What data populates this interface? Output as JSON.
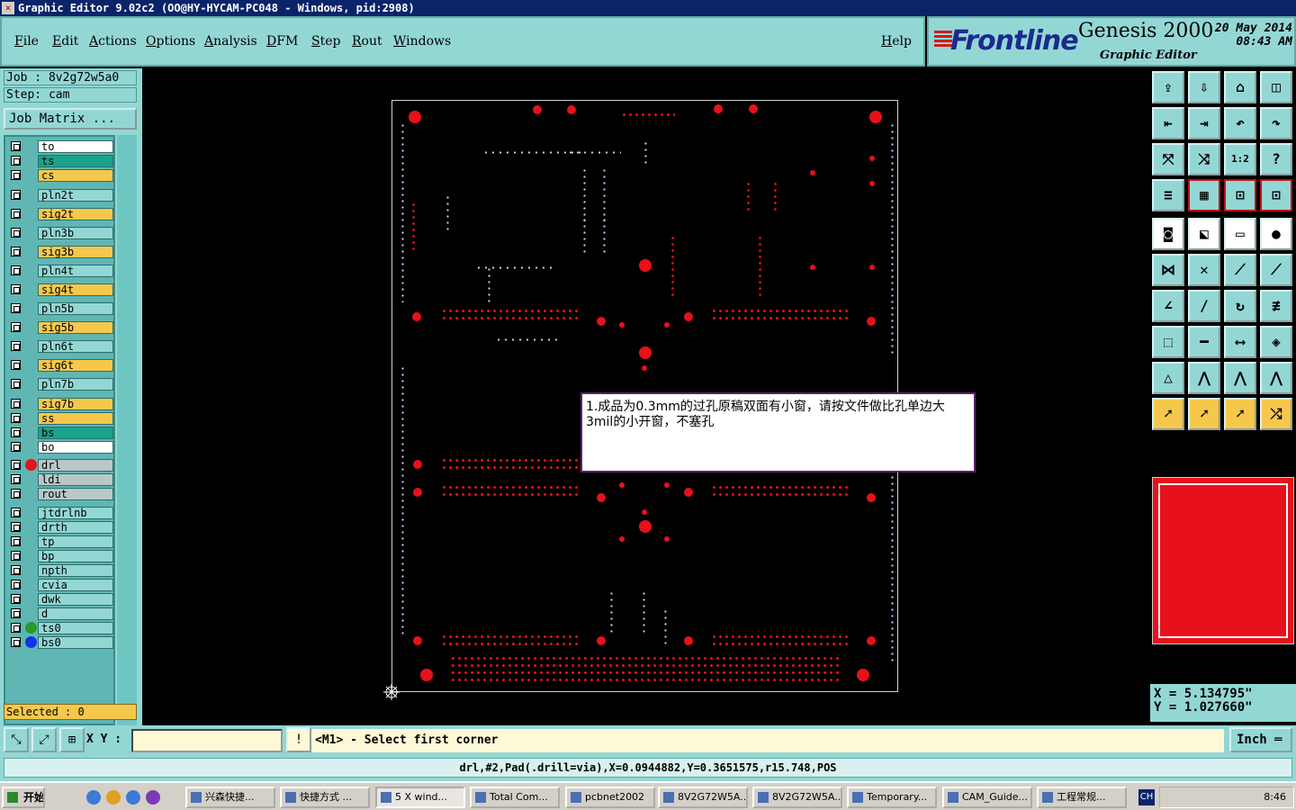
{
  "window": {
    "title": "Graphic Editor 9.02c2 (OO@HY-HYCAM-PC048 - Windows, pid:2908)"
  },
  "menu": {
    "file": "File",
    "edit": "Edit",
    "actions": "Actions",
    "options": "Options",
    "analysis": "Analysis",
    "dfm": "DFM",
    "step": "Step",
    "rout": "Rout",
    "windows": "Windows",
    "help": "Help"
  },
  "brand": {
    "logo": "Frontline",
    "product": "Genesis 2000",
    "subtitle": "Graphic Editor",
    "date": "20 May 2014",
    "time": "08:43 AM"
  },
  "job": {
    "job_line": "Job : 8v2g72w5a0",
    "step_line": "Step: cam",
    "matrix_button": "Job Matrix ..."
  },
  "colors": {
    "cyan": "#93d7d5",
    "green": "#1aa38a",
    "yellow": "#f5c84c",
    "white": "#ffffff",
    "gray": "#b8c8c8",
    "red": "#e8101a",
    "blue": "#1233e8",
    "darkgreen": "#2a9a2a"
  },
  "layers": [
    {
      "name": "to"
    },
    {
      "name": "ts"
    },
    {
      "name": "cs"
    },
    {
      "name": "pln2t"
    },
    {
      "name": "sig2t"
    },
    {
      "name": "pln3b"
    },
    {
      "name": "sig3b"
    },
    {
      "name": "pln4t"
    },
    {
      "name": "sig4t"
    },
    {
      "name": "pln5b"
    },
    {
      "name": "sig5b"
    },
    {
      "name": "pln6t"
    },
    {
      "name": "sig6t"
    },
    {
      "name": "pln7b"
    },
    {
      "name": "sig7b"
    },
    {
      "name": "ss"
    },
    {
      "name": "bs"
    },
    {
      "name": "bo"
    },
    {
      "name": "drl"
    },
    {
      "name": "ldi"
    },
    {
      "name": "rout"
    },
    {
      "name": "jtdrlnb"
    },
    {
      "name": "drth"
    },
    {
      "name": "tp"
    },
    {
      "name": "bp"
    },
    {
      "name": "npth"
    },
    {
      "name": "cvia"
    },
    {
      "name": "dwk"
    },
    {
      "name": "d"
    },
    {
      "name": "ts0"
    },
    {
      "name": "bs0"
    }
  ],
  "selected": "Selected : 0",
  "note": {
    "text": "1.成品为0.3mm的过孔原稿双面有小窗，请按文件做比孔单边大3mil的小开窗，不塞孔"
  },
  "coords": {
    "x": "X = 5.134795\"",
    "y": "Y = 1.027660\""
  },
  "command": {
    "xy_label": "X Y :",
    "xy_value": "",
    "prompt": "<M1> - Select first corner",
    "unit": "Inch"
  },
  "status": {
    "text": "drl,#2,Pad(.drill=via),X=0.0944882,Y=0.3651575,r15.748,POS"
  },
  "taskbar": {
    "start": "开始",
    "tasks": [
      "兴森快捷...",
      "快捷方式 ...",
      "5 X wind...",
      "Total Com...",
      "pcbnet2002",
      "8V2G72W5A...",
      "8V2G72W5A...",
      "Temporary...",
      "CAM_Guide...",
      "工程常规..."
    ],
    "ime": "CH",
    "time": "8:46"
  }
}
